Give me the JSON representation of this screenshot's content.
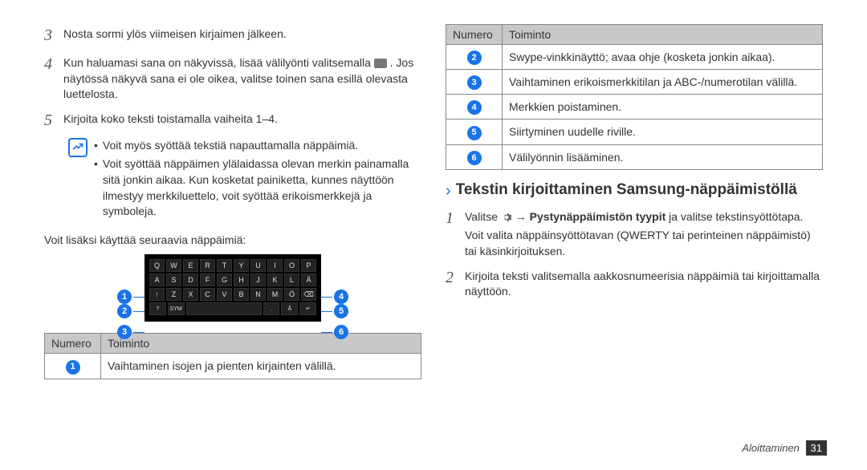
{
  "left": {
    "step3": "Nosta sormi ylös viimeisen kirjaimen jälkeen.",
    "step4": "Kun haluamasi sana on näkyvissä, lisää välilyönti valitsemalla ",
    "step4b": ". Jos näytössä näkyvä sana ei ole oikea, valitse toinen sana esillä olevasta luettelosta.",
    "step5": "Kirjoita koko teksti toistamalla vaiheita 1–4.",
    "note1": "Voit myös syöttää tekstiä napauttamalla näppäimiä.",
    "note2": "Voit syöttää näppäimen ylälaidassa olevan merkin painamalla sitä jonkin aikaa. Kun kosketat painiketta, kunnes näyttöön ilmestyy merkkiluettelo, voit syöttää erikoismerkkejä ja symboleja.",
    "extraKeys": "Voit lisäksi käyttää seuraavia näppäimiä:",
    "tbl": {
      "h1": "Numero",
      "h2": "Toiminto",
      "r1": "Vaihtaminen isojen ja pienten kirjainten välillä."
    }
  },
  "right": {
    "tbl": {
      "h1": "Numero",
      "h2": "Toiminto",
      "r2": "Swype-vinkkinäyttö; avaa ohje (kosketa jonkin aikaa).",
      "r3": "Vaihtaminen erikoismerkkitilan ja ABC-/numerotilan välillä.",
      "r4": "Merkkien poistaminen.",
      "r5": "Siirtyminen uudelle riville.",
      "r6": "Välilyönnin lisääminen."
    },
    "heading": "Tekstin kirjoittaminen Samsung-näppäimistöllä",
    "step1a": "Valitse ",
    "step1b": " → ",
    "step1bold": "Pystynäppäimistön tyypit",
    "step1c": " ja valitse tekstinsyöttötapa.",
    "step1d": "Voit valita näppäinsyöttötavan (QWERTY tai perinteinen näppäimistö) tai käsinkirjoituksen.",
    "step2": "Kirjoita teksti valitsemalla aakkosnumeerisia näppäimiä tai kirjoittamalla näyttöön."
  },
  "footer": {
    "section": "Aloittaminen",
    "page": "31"
  },
  "keyboard": {
    "row1": [
      "Q",
      "W",
      "E",
      "R",
      "T",
      "Y",
      "U",
      "I",
      "O",
      "P"
    ],
    "row2": [
      "A",
      "S",
      "D",
      "F",
      "G",
      "H",
      "J",
      "K",
      "L",
      "Ä"
    ],
    "row3": [
      "↑",
      "Z",
      "X",
      "C",
      "V",
      "B",
      "N",
      "M",
      "Ö",
      "⌫"
    ],
    "row4": [
      "?",
      "SYM",
      " ",
      ".",
      "Å",
      "↵"
    ]
  }
}
